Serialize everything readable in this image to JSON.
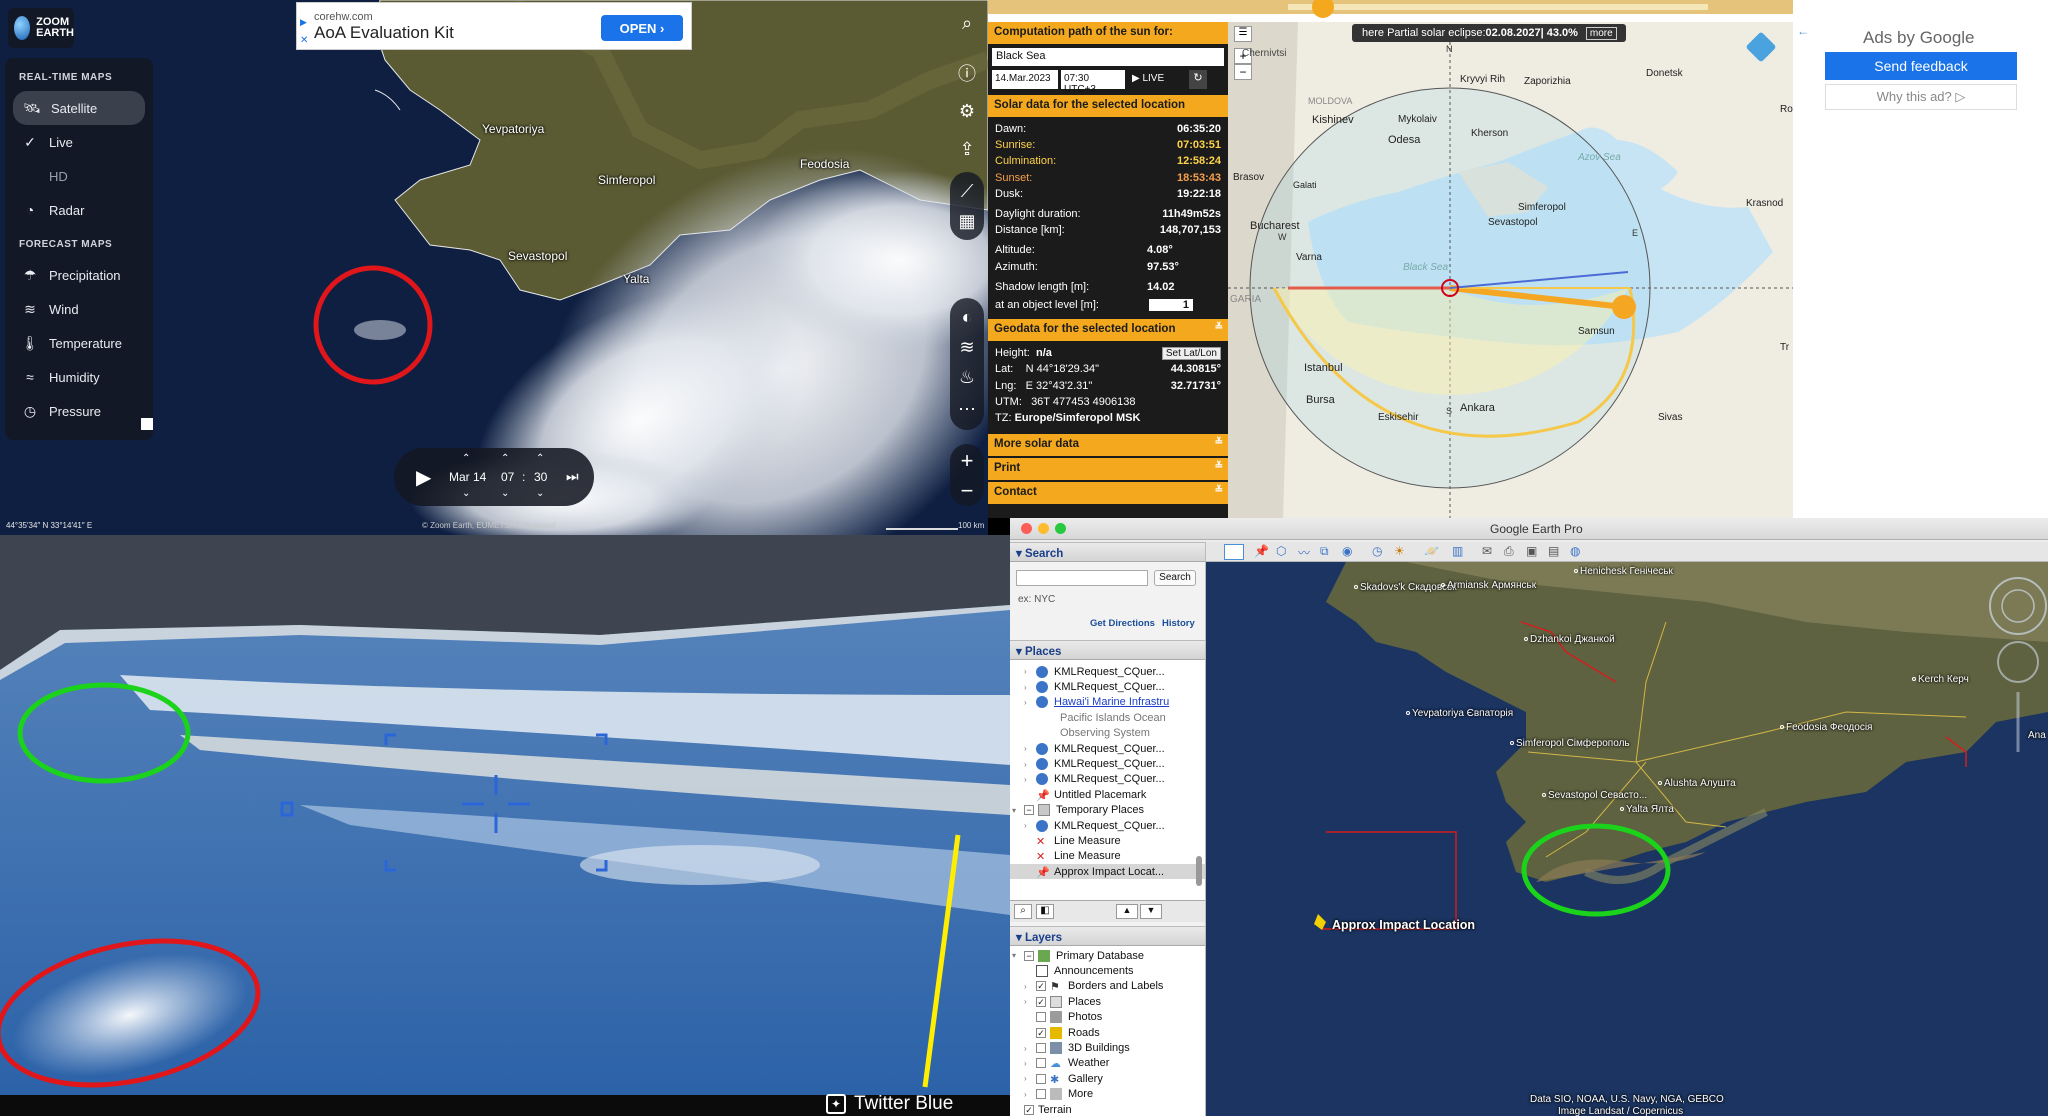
{
  "zoom_earth": {
    "logo_line1": "ZOOM",
    "logo_line2": "EARTH",
    "ad": {
      "domain": "corehw.com",
      "title": "AoA Evaluation Kit",
      "button": "OPEN"
    },
    "sections": {
      "realtime": "REAL-TIME MAPS",
      "forecast": "FORECAST MAPS"
    },
    "realtime_items": [
      "Satellite",
      "Live",
      "HD",
      "Radar"
    ],
    "forecast_items": [
      "Precipitation",
      "Wind",
      "Temperature",
      "Humidity",
      "Pressure"
    ],
    "cities": {
      "yevpatoriya": "Yevpatoriya",
      "simferopol": "Simferopol",
      "feodosia": "Feodosia",
      "sevastopol": "Sevastopol",
      "yalta": "Yalta"
    },
    "playback": {
      "date": "Mar 14",
      "hour": "07",
      "minute": "30"
    },
    "coords": "44°35′34″ N   33°14′41″ E",
    "attribution": "© Zoom Earth, EUMETSAT, Meteosat",
    "scale": "100 km"
  },
  "sun_calc": {
    "eclipse_prefix": "here Partial solar eclipse: ",
    "eclipse_date": "02.08.2027",
    "eclipse_pct": " | 43.0%",
    "more_btn": "more",
    "comp_path_header": "Computation path of the sun for:",
    "location": "Black Sea",
    "date": "14.Mar.2023",
    "time": "07:30 UTC+3",
    "live_btn": "LIVE",
    "solar_header": "Solar data for the selected location",
    "rows": [
      {
        "label": "Dawn:",
        "value": "06:35:20"
      },
      {
        "label": "Sunrise:",
        "value": "07:03:51"
      },
      {
        "label": "Culmination:",
        "value": "12:58:24"
      },
      {
        "label": "Sunset:",
        "value": "18:53:43"
      },
      {
        "label": "Dusk:",
        "value": "19:22:18"
      },
      {
        "label": "Daylight duration:",
        "value": "11h49m52s"
      },
      {
        "label": "Distance [km]:",
        "value": "148,707,153"
      },
      {
        "label": "Altitude:",
        "value": "4.08°"
      },
      {
        "label": "Azimuth:",
        "value": "97.53°"
      },
      {
        "label": "Shadow length [m]:",
        "value": "14.02"
      },
      {
        "label": "at an object level [m]:",
        "value": "1"
      }
    ],
    "geo_header": "Geodata for the selected location",
    "geo": {
      "height_label": "Height:",
      "height_value": "n/a",
      "set_btn": "Set Lat/Lon",
      "lat_label": "Lat:",
      "lat_dms": "N 44°18'29.34\"",
      "lat_dec": "44.30815°",
      "lng_label": "Lng:",
      "lng_dms": "E 32°43'2.31\"",
      "lng_dec": "32.71731°",
      "utm_label": "UTM:",
      "utm_value": "36T 477453 4906138",
      "tz_label": "TZ:",
      "tz_value": "Europe/Simferopol  MSK"
    },
    "more_solar": "More solar data",
    "print": "Print",
    "contact": "Contact",
    "map_labels": {
      "chernivtsi": "Chernivtsi",
      "moldova": "MOLDOVA",
      "kishinev": "Kishinev",
      "mykolaiv": "Mykolaiv",
      "kryvyi": "Kryvyi Rih",
      "zaporizhia": "Zaporizhia",
      "donetsk": "Donetsk",
      "odesa": "Odesa",
      "kherson": "Kherson",
      "azov": "Azov Sea",
      "brasov": "Brasov",
      "galati": "Galati",
      "krasnodar": "Krasnod",
      "simferopol": "Simferopol",
      "sevastopol": "Sevastopol",
      "bucharest": "Bucharest",
      "black_sea": "Black Sea",
      "varna": "Varna",
      "garia": "GARIA",
      "istanbul": "Istanbul",
      "samsun": "Samsun",
      "bursa": "Bursa",
      "ankara": "Ankara",
      "eskisehir": "Eskisehir",
      "sivas": "Sivas",
      "ro": "Ro",
      "tr": "Tr",
      "n": "N",
      "s": "S",
      "e": "E",
      "w": "W"
    },
    "ads": {
      "title": "Ads by Google",
      "send": "Send feedback",
      "why": "Why this ad?"
    }
  },
  "drone": {
    "twitter": "Twitter Blue"
  },
  "google_earth": {
    "title": "Google Earth Pro",
    "search_header": "Search",
    "search_btn": "Search",
    "search_example": "ex: NYC",
    "get_directions": "Get Directions",
    "history": "History",
    "places_header": "Places",
    "places": [
      "KMLRequest_CQuer...",
      "KMLRequest_CQuer...",
      "Hawai'i Marine Infrastru",
      "KMLRequest_CQuer...",
      "KMLRequest_CQuer...",
      "KMLRequest_CQuer...",
      "Untitled Placemark",
      "Temporary Places",
      "KMLRequest_CQuer...",
      "Line Measure",
      "Line Measure",
      "Approx Impact Locat..."
    ],
    "hawaii_sub1": "Pacific Islands Ocean",
    "hawaii_sub2": "Observing System",
    "layers_header": "Layers",
    "layers": [
      "Primary Database",
      "Announcements",
      "Borders and Labels",
      "Places",
      "Photos",
      "Roads",
      "3D Buildings",
      "Weather",
      "Gallery",
      "More",
      "Terrain"
    ],
    "map_labels": {
      "skadovsk": "Skadovs'k Скадовськ",
      "armiansk": "Armiansk Армянськ",
      "henichesk": "Henichesk Генічеськ",
      "dzhankoi": "Dzhankoi Джанкой",
      "kerch": "Kerch Керч",
      "yevpatoriya": "Yevpatoriya Євпаторія",
      "feodosiya": "Feodosia Феодосія",
      "simferopol": "Simferopol Сімферополь",
      "alushta": "Alushta Алушта",
      "sevastopol": "Sevastopol Севасто...",
      "yalta": "Yalta Ялта",
      "ana": "Ana",
      "impact": "Approx Impact Location"
    },
    "attribution1": "Data SIO, NOAA, U.S. Navy, NGA, GEBCO",
    "attribution2": "Image Landsat / Copernicus"
  }
}
